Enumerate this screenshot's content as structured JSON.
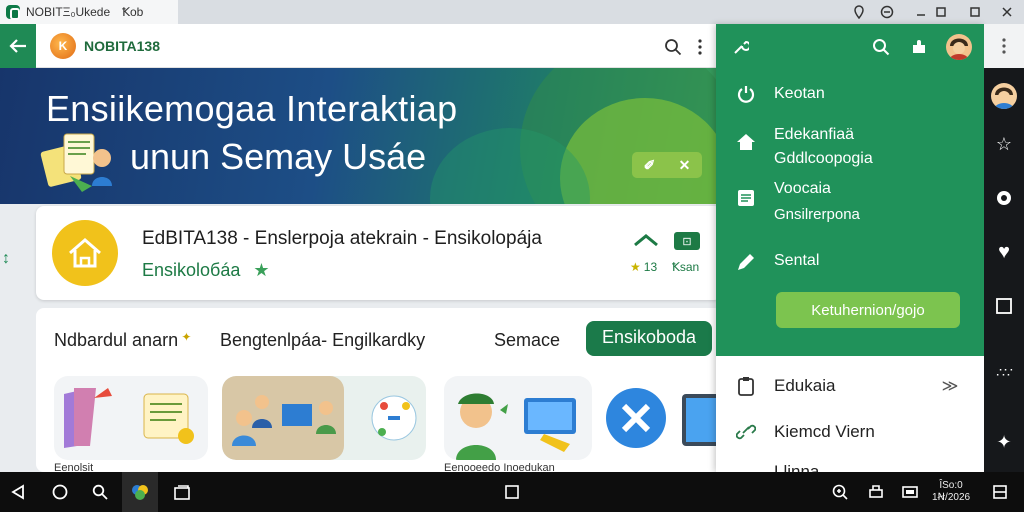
{
  "window": {
    "tab_title": "NOBITΞ₀Ukede",
    "tab_extra": "Ꝁob"
  },
  "appbar": {
    "title": "NOBITA138"
  },
  "banner": {
    "line1": "Ensiikemogaa Interaktiap",
    "line2": "unun Semay Usáe"
  },
  "featured": {
    "title": "EdBITA138 - Enslerpoja atekrain - Ensikolopája",
    "subtitle": "Ensikolобáa",
    "stat_rating": "13",
    "stat_label": "Ꝁsan"
  },
  "filter_tabs": [
    {
      "label": "Ndbardul anarn"
    },
    {
      "label": "Bengtenlpáa- Engilkardky"
    },
    {
      "label": "Semace"
    },
    {
      "label": "Ensikoboda"
    }
  ],
  "thumb_captions": [
    "Eenolsit",
    "Eenooeedo  Inoedukan"
  ],
  "drawer": {
    "items_green": [
      {
        "label": "Keotan",
        "icon": "power-icon"
      },
      {
        "label": "Edekanfiaä",
        "label2": "Gddlcoopogia",
        "icon": "home-icon"
      },
      {
        "label": "Voocaia",
        "label2": "Gnsilrerpona",
        "icon": "list-icon"
      },
      {
        "label": "Sental",
        "icon": "tag-icon"
      }
    ],
    "cta": "Ketuhernion/gojo",
    "items_white": [
      {
        "label": "Edukaia",
        "icon": "clipboard-icon"
      },
      {
        "label": "Kiemcd Viern",
        "icon": "link-icon"
      },
      {
        "label": "Llinna",
        "icon": "person-icon"
      }
    ]
  },
  "taskbar": {
    "time": "ÎSo:0",
    "date": "1Ꞥ/2026"
  },
  "colors": {
    "primary_green": "#20925a",
    "accent_light_green": "#7cc44f",
    "banner_navy": "#17356b",
    "yellow": "#f1c21b"
  }
}
